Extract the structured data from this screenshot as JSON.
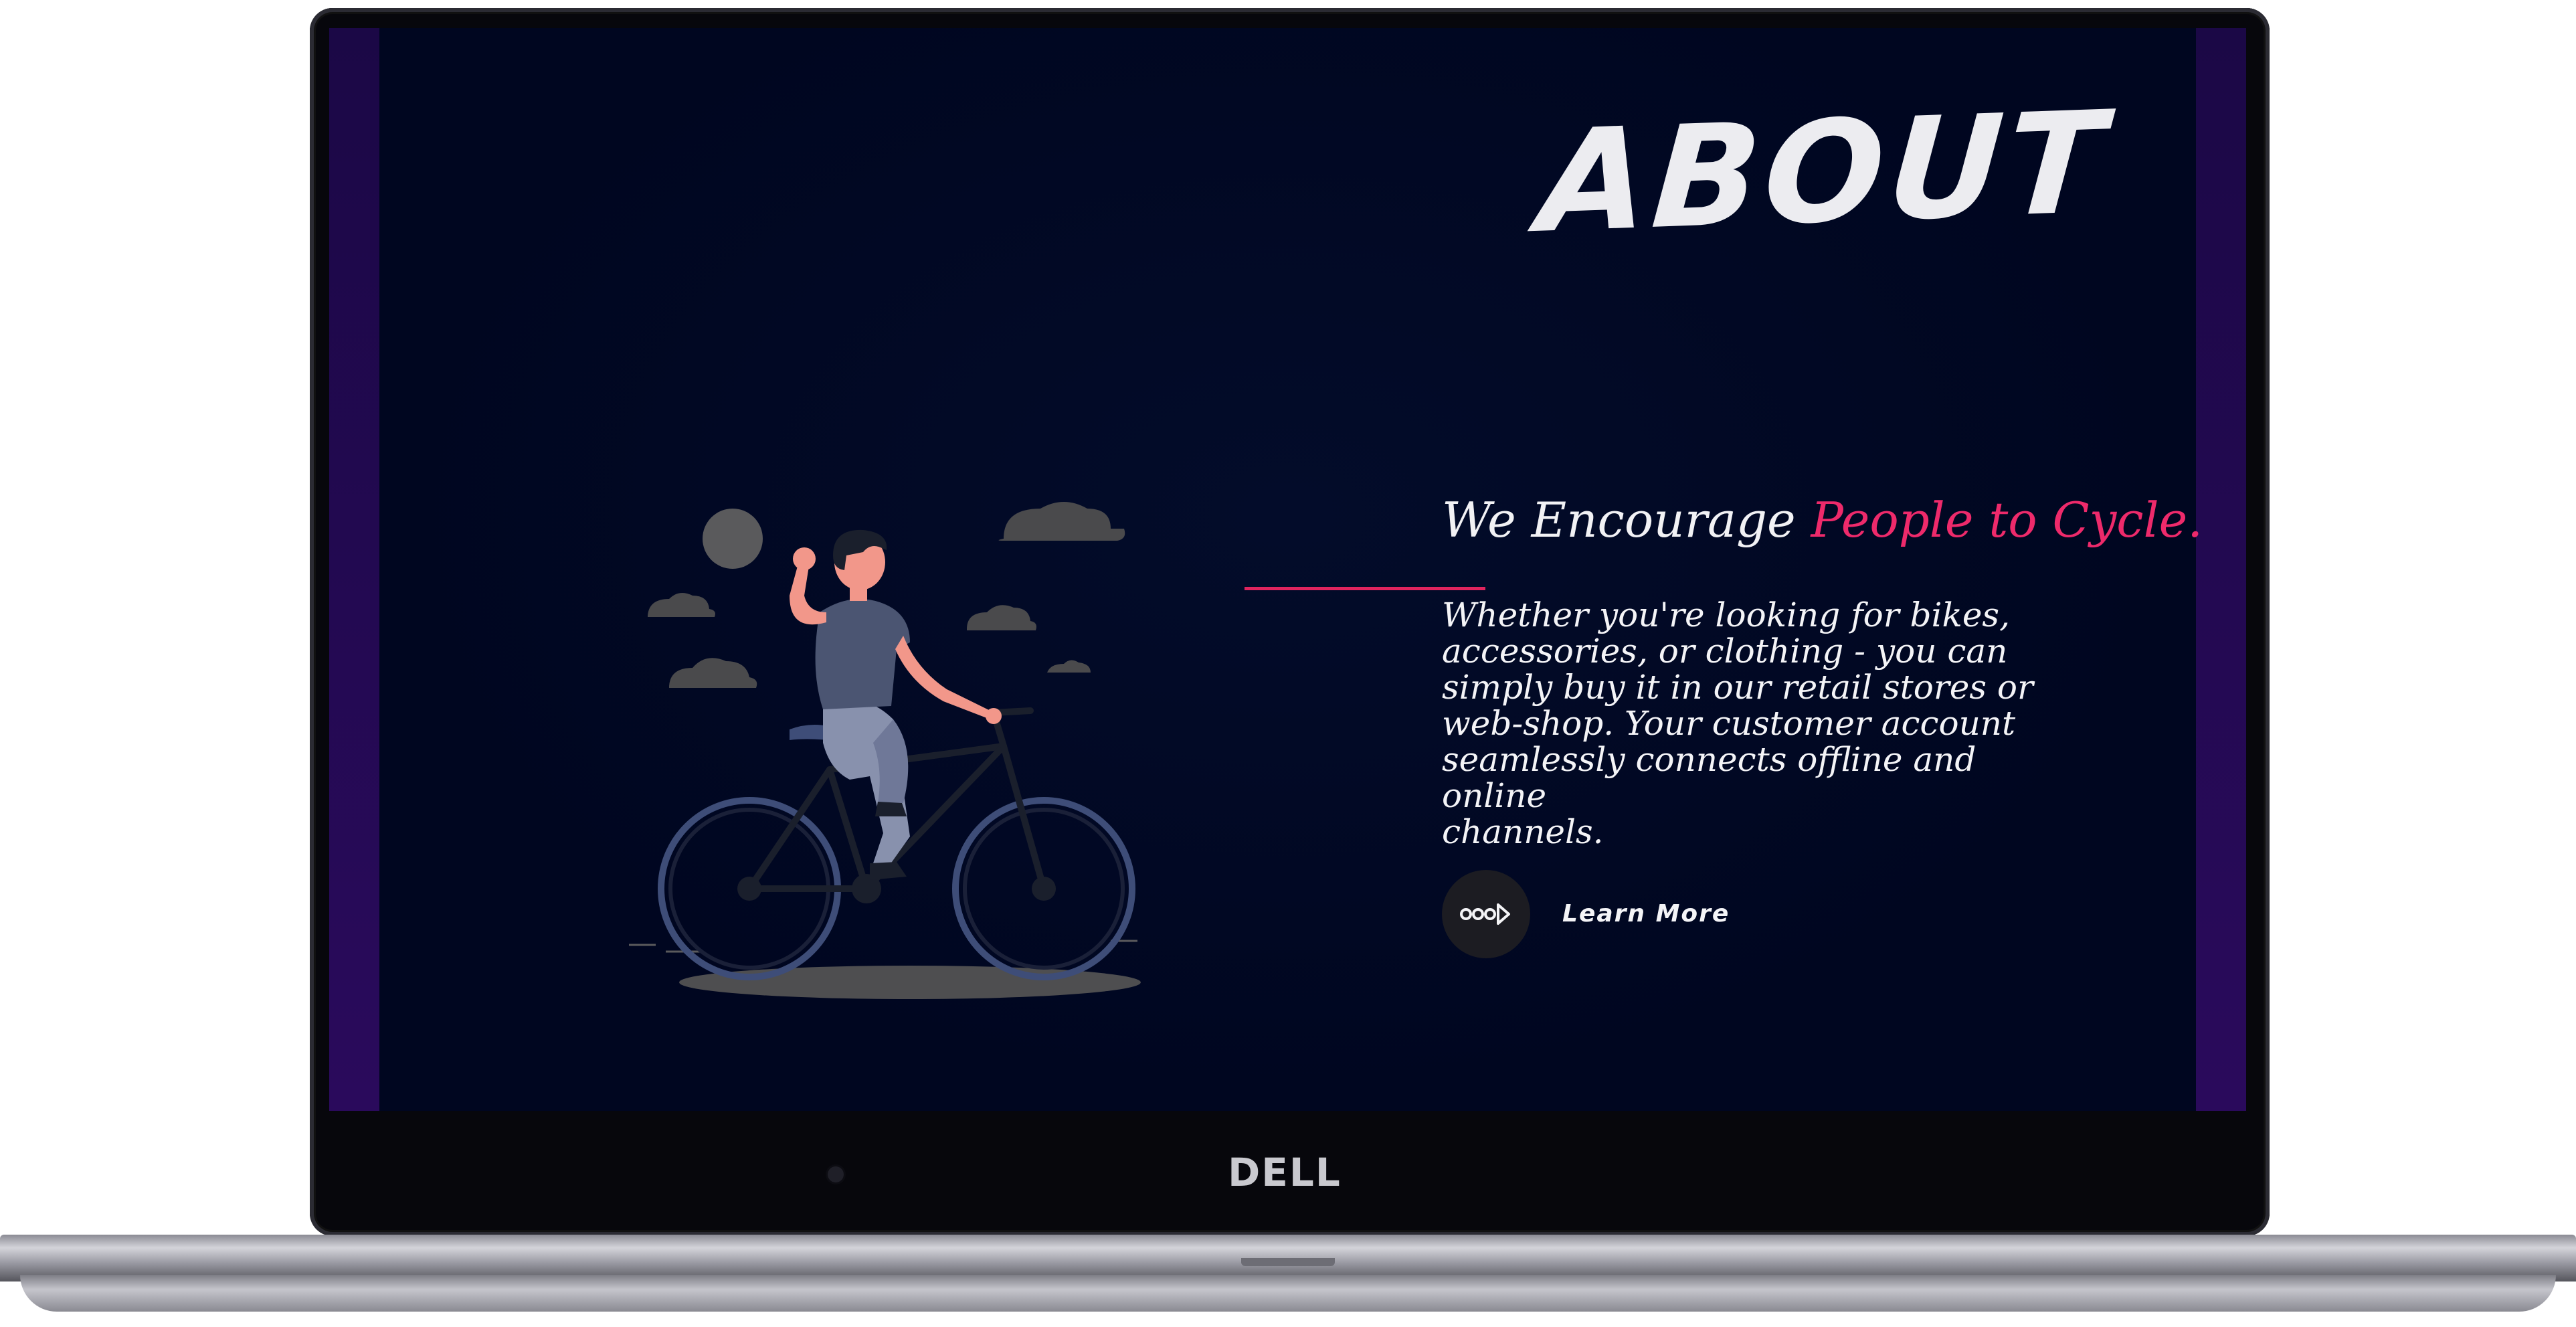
{
  "page": {
    "title": "ABOUT",
    "headline_plain": "We Encourage",
    "headline_accent": "People to Cycle.",
    "body_lines": [
      "Whether you're looking for bikes,",
      "accessories, or clothing - you can",
      "simply buy it in our retail stores or",
      "web-shop. Your customer account",
      "seamlessly connects offline and online",
      "channels."
    ],
    "cta_label": "Learn More",
    "cta_icon": "arrow-dots-icon"
  },
  "device": {
    "brand": "DELL"
  },
  "colors": {
    "background": "#000620",
    "accent": "#ee2a6b",
    "side_bars": "#2a0a5c",
    "text": "#f4f4f7",
    "cta_circle": "#1c1c22"
  }
}
